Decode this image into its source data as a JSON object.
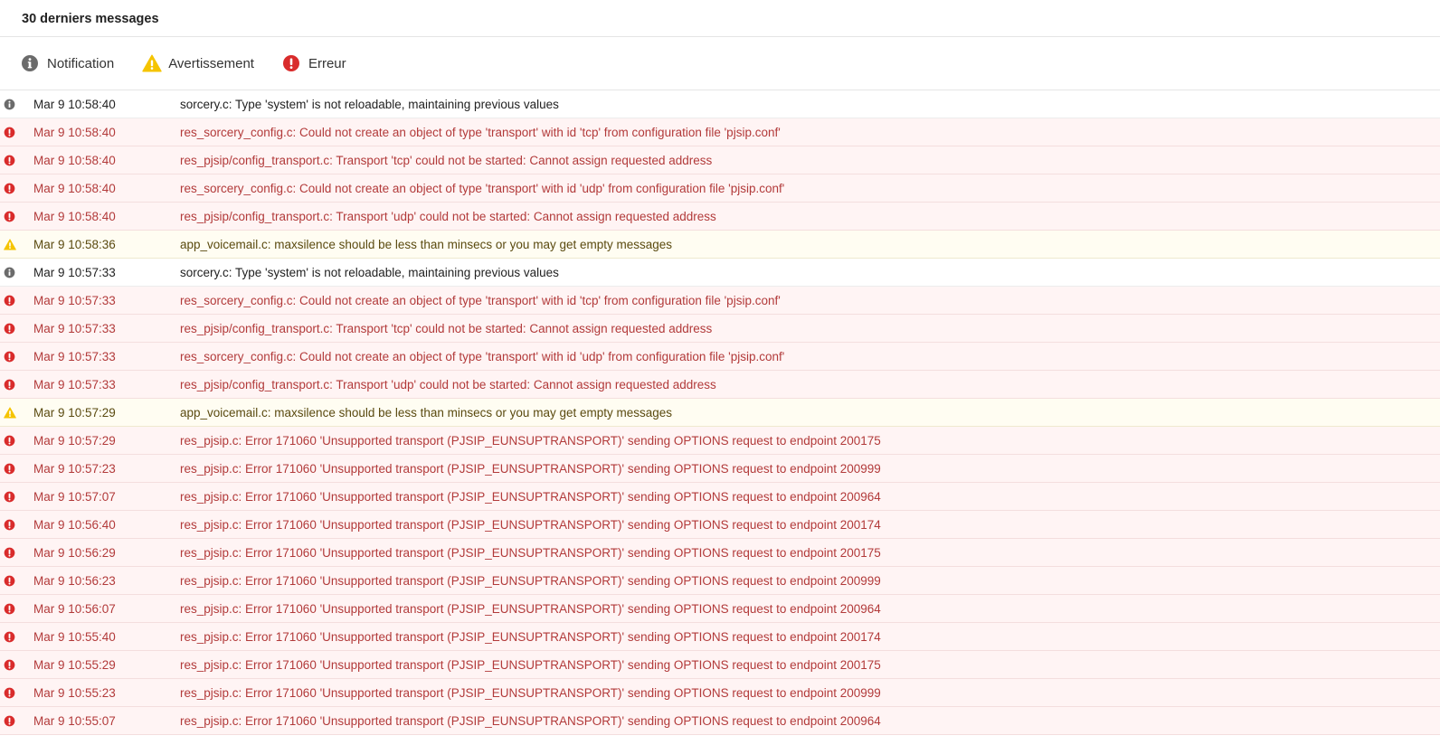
{
  "header": {
    "title": "30 derniers messages"
  },
  "legend": [
    {
      "level": "info",
      "label": "Notification",
      "icon": "info-icon"
    },
    {
      "level": "warning",
      "label": "Avertissement",
      "icon": "warning-icon"
    },
    {
      "level": "error",
      "label": "Erreur",
      "icon": "error-icon"
    }
  ],
  "colors": {
    "info": "#6b6b6b",
    "warning": "#f5c400",
    "error": "#d92b2b"
  },
  "messages": [
    {
      "level": "info",
      "time": "Mar 9 10:58:40",
      "text": "sorcery.c: Type 'system' is not reloadable, maintaining previous values"
    },
    {
      "level": "error",
      "time": "Mar 9 10:58:40",
      "text": "res_sorcery_config.c: Could not create an object of type 'transport' with id 'tcp' from configuration file 'pjsip.conf'"
    },
    {
      "level": "error",
      "time": "Mar 9 10:58:40",
      "text": "res_pjsip/config_transport.c: Transport 'tcp' could not be started: Cannot assign requested address"
    },
    {
      "level": "error",
      "time": "Mar 9 10:58:40",
      "text": "res_sorcery_config.c: Could not create an object of type 'transport' with id 'udp' from configuration file 'pjsip.conf'"
    },
    {
      "level": "error",
      "time": "Mar 9 10:58:40",
      "text": "res_pjsip/config_transport.c: Transport 'udp' could not be started: Cannot assign requested address"
    },
    {
      "level": "warning",
      "time": "Mar 9 10:58:36",
      "text": "app_voicemail.c: maxsilence should be less than minsecs or you may get empty messages"
    },
    {
      "level": "info",
      "time": "Mar 9 10:57:33",
      "text": "sorcery.c: Type 'system' is not reloadable, maintaining previous values"
    },
    {
      "level": "error",
      "time": "Mar 9 10:57:33",
      "text": "res_sorcery_config.c: Could not create an object of type 'transport' with id 'tcp' from configuration file 'pjsip.conf'"
    },
    {
      "level": "error",
      "time": "Mar 9 10:57:33",
      "text": "res_pjsip/config_transport.c: Transport 'tcp' could not be started: Cannot assign requested address"
    },
    {
      "level": "error",
      "time": "Mar 9 10:57:33",
      "text": "res_sorcery_config.c: Could not create an object of type 'transport' with id 'udp' from configuration file 'pjsip.conf'"
    },
    {
      "level": "error",
      "time": "Mar 9 10:57:33",
      "text": "res_pjsip/config_transport.c: Transport 'udp' could not be started: Cannot assign requested address"
    },
    {
      "level": "warning",
      "time": "Mar 9 10:57:29",
      "text": "app_voicemail.c: maxsilence should be less than minsecs or you may get empty messages"
    },
    {
      "level": "error",
      "time": "Mar 9 10:57:29",
      "text": "res_pjsip.c: Error 171060 'Unsupported transport (PJSIP_EUNSUPTRANSPORT)' sending OPTIONS request to endpoint 200175"
    },
    {
      "level": "error",
      "time": "Mar 9 10:57:23",
      "text": "res_pjsip.c: Error 171060 'Unsupported transport (PJSIP_EUNSUPTRANSPORT)' sending OPTIONS request to endpoint 200999"
    },
    {
      "level": "error",
      "time": "Mar 9 10:57:07",
      "text": "res_pjsip.c: Error 171060 'Unsupported transport (PJSIP_EUNSUPTRANSPORT)' sending OPTIONS request to endpoint 200964"
    },
    {
      "level": "error",
      "time": "Mar 9 10:56:40",
      "text": "res_pjsip.c: Error 171060 'Unsupported transport (PJSIP_EUNSUPTRANSPORT)' sending OPTIONS request to endpoint 200174"
    },
    {
      "level": "error",
      "time": "Mar 9 10:56:29",
      "text": "res_pjsip.c: Error 171060 'Unsupported transport (PJSIP_EUNSUPTRANSPORT)' sending OPTIONS request to endpoint 200175"
    },
    {
      "level": "error",
      "time": "Mar 9 10:56:23",
      "text": "res_pjsip.c: Error 171060 'Unsupported transport (PJSIP_EUNSUPTRANSPORT)' sending OPTIONS request to endpoint 200999"
    },
    {
      "level": "error",
      "time": "Mar 9 10:56:07",
      "text": "res_pjsip.c: Error 171060 'Unsupported transport (PJSIP_EUNSUPTRANSPORT)' sending OPTIONS request to endpoint 200964"
    },
    {
      "level": "error",
      "time": "Mar 9 10:55:40",
      "text": "res_pjsip.c: Error 171060 'Unsupported transport (PJSIP_EUNSUPTRANSPORT)' sending OPTIONS request to endpoint 200174"
    },
    {
      "level": "error",
      "time": "Mar 9 10:55:29",
      "text": "res_pjsip.c: Error 171060 'Unsupported transport (PJSIP_EUNSUPTRANSPORT)' sending OPTIONS request to endpoint 200175"
    },
    {
      "level": "error",
      "time": "Mar 9 10:55:23",
      "text": "res_pjsip.c: Error 171060 'Unsupported transport (PJSIP_EUNSUPTRANSPORT)' sending OPTIONS request to endpoint 200999"
    },
    {
      "level": "error",
      "time": "Mar 9 10:55:07",
      "text": "res_pjsip.c: Error 171060 'Unsupported transport (PJSIP_EUNSUPTRANSPORT)' sending OPTIONS request to endpoint 200964"
    }
  ]
}
